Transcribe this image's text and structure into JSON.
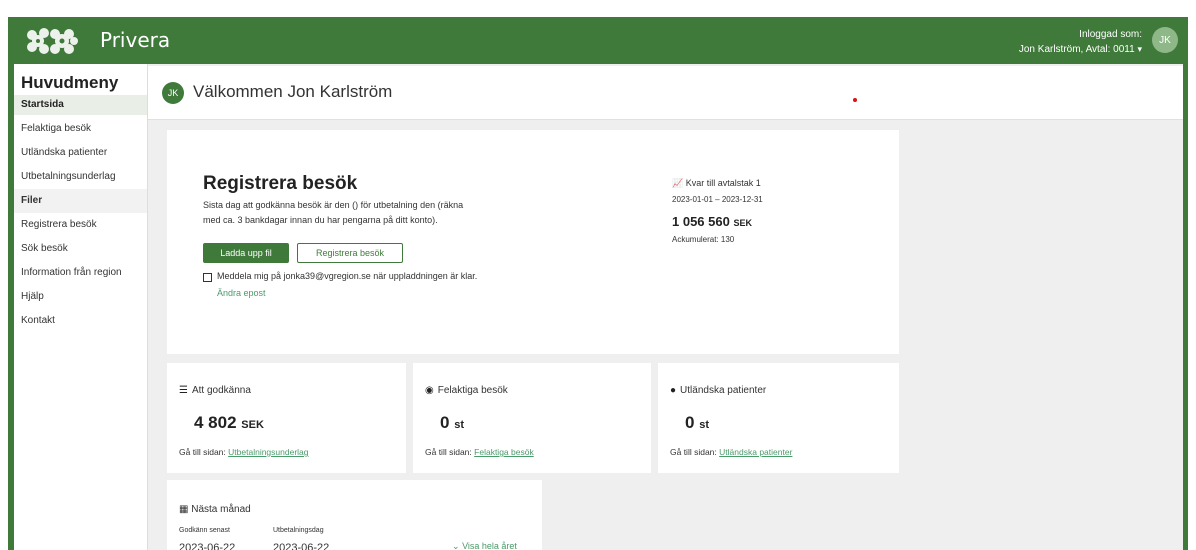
{
  "header": {
    "brand": "Privera",
    "logged_in_label": "Inloggad som:",
    "user_line": "Jon Karlström, Avtal: 0011",
    "avatar_initials": "JK",
    "brand_color": "#3f7a3a"
  },
  "sidebar": {
    "title": "Huvudmeny",
    "items": [
      {
        "label": "Startsida"
      },
      {
        "label": "Felaktiga besök"
      },
      {
        "label": "Utländska patienter"
      },
      {
        "label": "Utbetalningsunderlag"
      },
      {
        "label": "Filer"
      },
      {
        "label": "Registrera besök"
      },
      {
        "label": "Sök besök"
      },
      {
        "label": "Information från region"
      },
      {
        "label": "Hjälp"
      },
      {
        "label": "Kontakt"
      }
    ]
  },
  "welcome": {
    "avatar_initials": "JK",
    "text": "Välkommen Jon Karlström"
  },
  "register": {
    "title": "Registrera besök",
    "desc_line1": "Sista dag att godkänna besök är den () för utbetalning den (räkna",
    "desc_line2": "med ca. 3 bankdagar innan du har pengarna på ditt konto).",
    "upload_button": "Ladda upp fil",
    "register_button": "Registrera besök",
    "notify_label": "Meddela mig på jonka39@vgregion.se när uppladdningen är klar.",
    "change_email_link": "Ändra epost",
    "limit_label": "Kvar till avtalstak 1",
    "limit_dates": "2023-01-01 – 2023-12-31",
    "limit_amount": "1 056 560",
    "limit_unit": "SEK",
    "accumulated": "Ackumulerat: 130"
  },
  "stats": [
    {
      "title": "Att godkänna",
      "value": "4 802",
      "unit": "SEK",
      "link_prefix": "Gå till sidan:",
      "link": "Utbetalningsunderlag",
      "icon": "list-check-icon"
    },
    {
      "title": "Felaktiga besök",
      "value": "0",
      "unit": "st",
      "link_prefix": "Gå till sidan:",
      "link": "Felaktiga besök",
      "icon": "eye-icon"
    },
    {
      "title": "Utländska patienter",
      "value": "0",
      "unit": "st",
      "link_prefix": "Gå till sidan:",
      "link": "Utländska patienter",
      "icon": "globe-icon"
    }
  ],
  "next_month": {
    "title": "Nästa månad",
    "approve_label": "Godkänn senast",
    "payment_label": "Utbetalningsdag",
    "approve_date": "2023-06-22",
    "payment_date": "2023-06-22",
    "show_year_link": "Visa hela året"
  }
}
